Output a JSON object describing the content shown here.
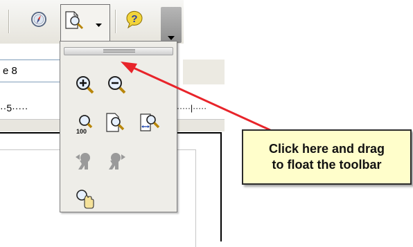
{
  "font_size_field": {
    "value": "e 8"
  },
  "ruler": {
    "left_text": "··5·····",
    "right_text": "·····|·····"
  },
  "toolbar": {
    "icons": [
      "navigator-icon",
      "zoom-icon",
      "dropdown-arrow-icon",
      "help-icon",
      "toolbar-overflow-icon"
    ]
  },
  "zoom_panel": {
    "drag_handle": "toolbar drag handle",
    "icons": [
      "zoom-in-icon",
      "zoom-out-icon",
      "zoom-100-icon",
      "zoom-whole-page-icon",
      "zoom-page-width-icon",
      "zoom-previous-icon",
      "zoom-next-icon",
      "shift-icon"
    ]
  },
  "callout": {
    "line1": "Click here and drag",
    "line2": "to float the toolbar"
  },
  "colors": {
    "arrow": "#e8242a",
    "callout_bg": "#fffecb",
    "help_icon": "#f2d43b"
  }
}
